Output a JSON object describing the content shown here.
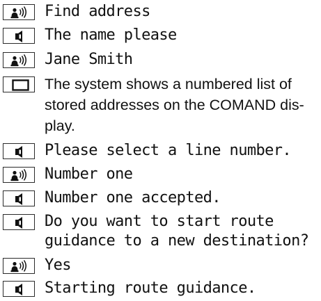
{
  "dialog": [
    {
      "speaker": "user",
      "icon": "voice-input-icon",
      "text": "Find address"
    },
    {
      "speaker": "system",
      "icon": "speaker-icon",
      "text": "The name please"
    },
    {
      "speaker": "user",
      "icon": "voice-input-icon",
      "text": "Jane Smith"
    },
    {
      "speaker": "display",
      "icon": "display-icon",
      "text_lines": [
        "The system shows a numbered list of",
        "stored addresses on the COMAND dis-",
        "play."
      ]
    },
    {
      "speaker": "system",
      "icon": "speaker-icon",
      "text": "Please select a line number."
    },
    {
      "speaker": "user",
      "icon": "voice-input-icon",
      "text": "Number one"
    },
    {
      "speaker": "system",
      "icon": "speaker-icon",
      "text": "Number one accepted."
    },
    {
      "speaker": "system",
      "icon": "speaker-icon",
      "text_lines": [
        "Do you want to start route",
        "guidance to a new destination?"
      ]
    },
    {
      "speaker": "user",
      "icon": "voice-input-icon",
      "text": "Yes"
    },
    {
      "speaker": "system",
      "icon": "speaker-icon",
      "text": "Starting route guidance."
    }
  ]
}
